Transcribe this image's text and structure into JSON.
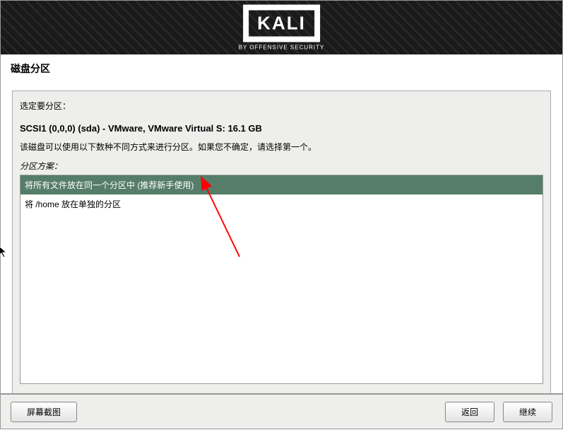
{
  "header": {
    "logo_text": "KALI",
    "logo_subtitle": "BY OFFENSIVE SECURITY"
  },
  "page_title": "磁盘分区",
  "main": {
    "instruction_select": "选定要分区：",
    "disk_info": "SCSI1 (0,0,0) (sda) - VMware, VMware Virtual S: 16.1 GB",
    "instruction_method": "该磁盘可以使用以下数种不同方式来进行分区。如果您不确定，请选择第一个。",
    "scheme_label": "分区方案：",
    "options": [
      {
        "label": "将所有文件放在同一个分区中 (推荐新手使用)",
        "selected": true
      },
      {
        "label": "将 /home 放在单独的分区",
        "selected": false
      }
    ]
  },
  "footer": {
    "screenshot_btn": "屏幕截图",
    "back_btn": "返回",
    "continue_btn": "继续"
  }
}
